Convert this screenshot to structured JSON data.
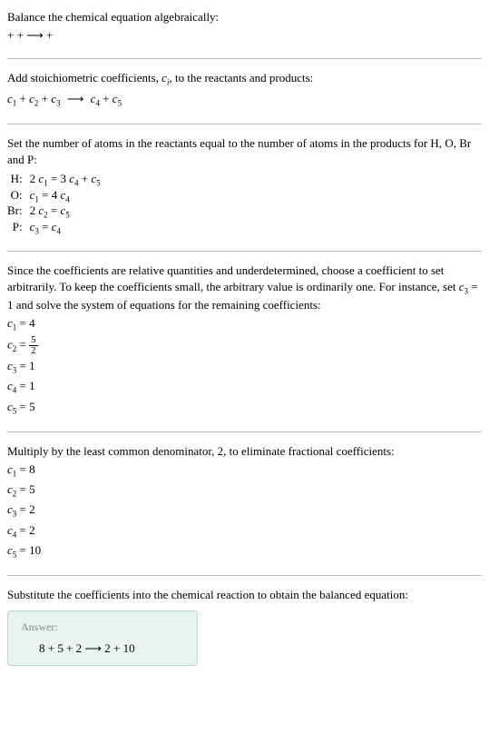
{
  "intro": {
    "title": "Balance the chemical equation algebraically:",
    "eq": " +  +  ⟶  + "
  },
  "step1": {
    "text": "Add stoichiometric coefficients, c_i, to the reactants and products:",
    "eq_parts": [
      "c",
      "1",
      " + c",
      "2",
      " + c",
      "3",
      "  ⟶ c",
      "4",
      " + c",
      "5"
    ]
  },
  "atoms": {
    "intro": "Set the number of atoms in the reactants equal to the number of atoms in the products for H, O, Br and P:",
    "rows": [
      {
        "label": "H:",
        "lhs_parts": [
          "2 c",
          "1",
          " = 3 c",
          "4",
          " + c",
          "5"
        ]
      },
      {
        "label": "O:",
        "lhs_parts": [
          "c",
          "1",
          " = 4 c",
          "4"
        ]
      },
      {
        "label": "Br:",
        "lhs_parts": [
          "2 c",
          "2",
          " = c",
          "5"
        ]
      },
      {
        "label": "P:",
        "lhs_parts": [
          "c",
          "3",
          " = c",
          "4"
        ]
      }
    ]
  },
  "solve1": {
    "intro": "Since the coefficients are relative quantities and underdetermined, choose a coefficient to set arbitrarily. To keep the coefficients small, the arbitrary value is ordinarily one. For instance, set c_3 = 1 and solve the system of equations for the remaining coefficients:",
    "rows": [
      {
        "var": "c",
        "sub": "1",
        "val": "4",
        "frac": null
      },
      {
        "var": "c",
        "sub": "2",
        "val": null,
        "frac": {
          "n": "5",
          "d": "2"
        }
      },
      {
        "var": "c",
        "sub": "3",
        "val": "1",
        "frac": null
      },
      {
        "var": "c",
        "sub": "4",
        "val": "1",
        "frac": null
      },
      {
        "var": "c",
        "sub": "5",
        "val": "5",
        "frac": null
      }
    ]
  },
  "solve2": {
    "intro": "Multiply by the least common denominator, 2, to eliminate fractional coefficients:",
    "rows": [
      {
        "var": "c",
        "sub": "1",
        "val": "8"
      },
      {
        "var": "c",
        "sub": "2",
        "val": "5"
      },
      {
        "var": "c",
        "sub": "3",
        "val": "2"
      },
      {
        "var": "c",
        "sub": "4",
        "val": "2"
      },
      {
        "var": "c",
        "sub": "5",
        "val": "10"
      }
    ]
  },
  "final": {
    "intro": "Substitute the coefficients into the chemical reaction to obtain the balanced equation:",
    "answer_label": "Answer:",
    "answer_eq": "8  + 5  + 2  ⟶ 2  + 10 "
  }
}
